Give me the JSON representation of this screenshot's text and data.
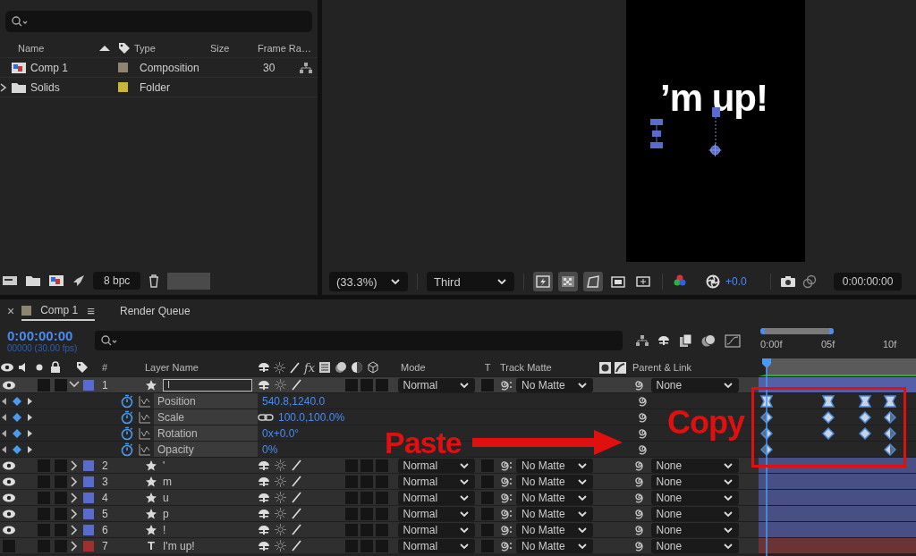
{
  "project": {
    "columns": [
      {
        "label": "Name",
        "sorted": true
      },
      {
        "label": "Type",
        "sorted": false
      },
      {
        "label": "Size",
        "sorted": false
      },
      {
        "label": "Frame Ra…",
        "sorted": false
      }
    ],
    "items": [
      {
        "name": "Comp 1",
        "kind": "composition",
        "color": "#8e8470",
        "type": "Composition",
        "frame_rate": "30"
      },
      {
        "name": "Solids",
        "kind": "folder",
        "color": "#c8b63a",
        "type": "Folder"
      }
    ],
    "bit_depth": "8 bpc"
  },
  "viewer": {
    "comp_text": "’m up!",
    "zoom": "(33.3%)",
    "view": "Third",
    "toggles": [
      {
        "on": true
      },
      {
        "on": true
      },
      {
        "on": true
      },
      {
        "on": false
      },
      {
        "on": false
      }
    ],
    "exposure": "+0.0",
    "timecode": "0:00:00:00"
  },
  "timeline": {
    "close": "×",
    "tabs": [
      {
        "label": "Comp 1",
        "selected": true,
        "color": "#8e8470"
      },
      {
        "label": "Render Queue",
        "selected": false
      }
    ],
    "menu": "≡",
    "time": "0:00:00:00",
    "frame_info": "00000 (30.00 fps)",
    "ruler": [
      "0:00f",
      "05f",
      "10f"
    ],
    "columns": {
      "number": "#",
      "layer_name": "Layer Name",
      "fx": "fx",
      "mode": "Mode",
      "t": "T",
      "track_matte": "Track Matte",
      "parent": "Parent & Link"
    },
    "layers": [
      {
        "number": "1",
        "name": "I",
        "kind": "shape",
        "color": "#5a6bd0",
        "visible": true,
        "expanded": true,
        "selected": true,
        "mode": "Normal",
        "track_matte": "No Matte",
        "parent": "None",
        "properties": [
          {
            "name": "Position",
            "value": "540.8,1240.0",
            "linked": false,
            "keyframes": [
              {
                "kind": "ease"
              },
              {
                "kind": "none"
              },
              {
                "kind": "none"
              },
              {
                "kind": "none"
              },
              {
                "kind": "none"
              },
              {
                "kind": "ease"
              },
              {
                "kind": "none"
              },
              {
                "kind": "none"
              },
              {
                "kind": "ease"
              },
              {
                "kind": "none"
              },
              {
                "kind": "ease"
              }
            ]
          },
          {
            "name": "Scale",
            "value": "100.0,100.0%",
            "linked": true,
            "keyframes": [
              {
                "kind": "start"
              },
              {
                "kind": "none"
              },
              {
                "kind": "none"
              },
              {
                "kind": "none"
              },
              {
                "kind": "none"
              },
              {
                "kind": "linear"
              },
              {
                "kind": "none"
              },
              {
                "kind": "none"
              },
              {
                "kind": "linear"
              },
              {
                "kind": "none"
              },
              {
                "kind": "end"
              }
            ]
          },
          {
            "name": "Rotation",
            "value": "0x+0.0°",
            "linked": false,
            "keyframes": [
              {
                "kind": "start"
              },
              {
                "kind": "none"
              },
              {
                "kind": "none"
              },
              {
                "kind": "none"
              },
              {
                "kind": "none"
              },
              {
                "kind": "linear"
              },
              {
                "kind": "none"
              },
              {
                "kind": "none"
              },
              {
                "kind": "linear"
              },
              {
                "kind": "none"
              },
              {
                "kind": "end"
              }
            ]
          },
          {
            "name": "Opacity",
            "value": "0%",
            "linked": false,
            "keyframes": [
              {
                "kind": "start"
              },
              {
                "kind": "none"
              },
              {
                "kind": "none"
              },
              {
                "kind": "none"
              },
              {
                "kind": "none"
              },
              {
                "kind": "none"
              },
              {
                "kind": "none"
              },
              {
                "kind": "none"
              },
              {
                "kind": "none"
              },
              {
                "kind": "none"
              },
              {
                "kind": "end"
              }
            ]
          }
        ]
      },
      {
        "number": "2",
        "name": "'",
        "kind": "shape",
        "color": "#5a6bd0",
        "visible": true,
        "selected": false,
        "expanded": false,
        "mode": "Normal",
        "track_matte": "No Matte",
        "parent": "None"
      },
      {
        "number": "3",
        "name": "m",
        "kind": "shape",
        "color": "#5a6bd0",
        "visible": true,
        "selected": false,
        "expanded": false,
        "mode": "Normal",
        "track_matte": "No Matte",
        "parent": "None"
      },
      {
        "number": "4",
        "name": "u",
        "kind": "shape",
        "color": "#5a6bd0",
        "visible": true,
        "selected": false,
        "expanded": false,
        "mode": "Normal",
        "track_matte": "No Matte",
        "parent": "None"
      },
      {
        "number": "5",
        "name": "p",
        "kind": "shape",
        "color": "#5a6bd0",
        "visible": true,
        "selected": false,
        "expanded": false,
        "mode": "Normal",
        "track_matte": "No Matte",
        "parent": "None"
      },
      {
        "number": "6",
        "name": "!",
        "kind": "shape",
        "color": "#5a6bd0",
        "visible": true,
        "selected": false,
        "expanded": false,
        "mode": "Normal",
        "track_matte": "No Matte",
        "parent": "None"
      },
      {
        "number": "7",
        "name": "I'm up!",
        "kind": "text",
        "glyph": "T",
        "color": "#a03030",
        "visible": false,
        "selected": false,
        "expanded": false,
        "mode": "Normal",
        "track_matte": "No Matte",
        "parent": "None"
      }
    ]
  },
  "annotations": {
    "copy": "Copy",
    "paste": "Paste"
  }
}
